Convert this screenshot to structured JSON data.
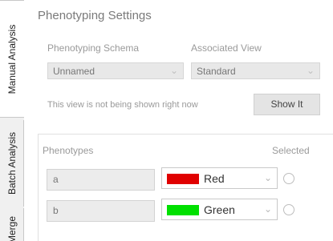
{
  "tabs": {
    "manual": "Manual Analysis",
    "batch": "Batch Analysis",
    "merge": "Merge"
  },
  "panel": {
    "title": "Phenotyping Settings",
    "schema_label": "Phenotyping Schema",
    "schema_value": "Unnamed",
    "view_label": "Associated View",
    "view_value": "Standard",
    "info_text": "This view is not being shown right now",
    "show_button": "Show It"
  },
  "phenotypes": {
    "header": "Phenotypes",
    "selected_header": "Selected",
    "rows": [
      {
        "name": "a",
        "color_name": "Red",
        "color": "#e00000",
        "selected": false
      },
      {
        "name": "b",
        "color_name": "Green",
        "color": "#00e000",
        "selected": false
      }
    ]
  }
}
